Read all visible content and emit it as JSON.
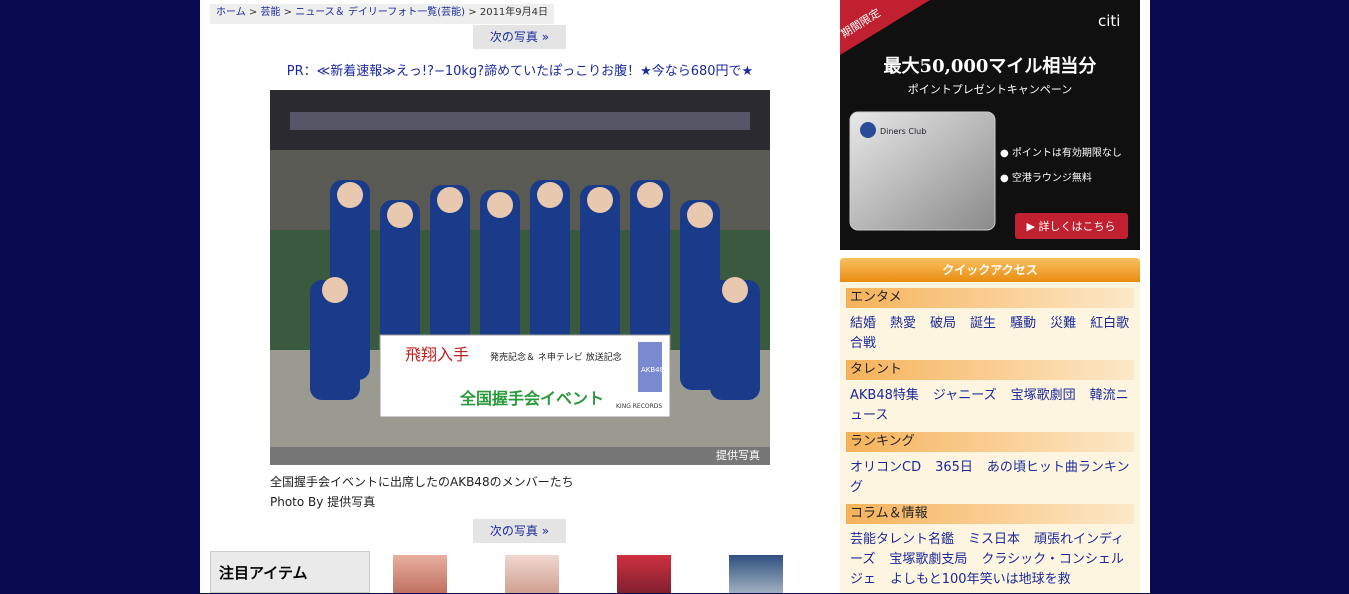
{
  "breadcrumb": {
    "home": "ホーム",
    "sep": " > ",
    "cat1": "芸能",
    "cat2": "ニュース＆ デイリーフォト一覧(芸能)",
    "date": "2011年9月4日"
  },
  "next_photo_label": "次の写真 »",
  "pr_text": "PR：≪新着速報≫えっ!?−10kg?諦めていたぽっこりお腹！★今なら680円で★",
  "photo": {
    "credit": "提供写真",
    "banner_text": "全国握手会イベント",
    "banner_left": "飛翔入手",
    "banner_right": "発売記念＆ ネ申テレビ 放送記念",
    "label_akb": "AKB48",
    "label_king": "KING RECORDS"
  },
  "caption": {
    "line1": "全国握手会イベントに出席したのAKB48のメンバーたち",
    "line2": "Photo By 提供写真"
  },
  "items_heading": "注目アイテム",
  "ad": {
    "badge": "期間限定",
    "brand": "citi",
    "headline": "最大50,000マイル相当分",
    "sub": "ポイントプレゼントキャンペーン",
    "point1": "● ポイントは有効期限なし",
    "point2": "● 空港ラウンジ無料",
    "cta": "▶ 詳しくはこちら",
    "card_name": "Diners Club"
  },
  "quick_access": {
    "title": "クイックアクセス",
    "sections": [
      {
        "title": "エンタメ",
        "links": [
          "結婚",
          "熱愛",
          "破局",
          "誕生",
          "騒動",
          "災難",
          "紅白歌合戦"
        ]
      },
      {
        "title": "タレント",
        "links": [
          "AKB48特集",
          "ジャニーズ",
          "宝塚歌劇団",
          "韓流ニュース"
        ]
      },
      {
        "title": "ランキング",
        "links": [
          "オリコンCD",
          "365日",
          "あの頃ヒット曲ランキング"
        ]
      },
      {
        "title": "コラム＆情報",
        "links": [
          "芸能タレント名鑑",
          "ミス日本",
          "頑張れインディーズ",
          "宝塚歌劇支局",
          "クラシック・コンシェルジェ",
          "よしもと100年笑いは地球を救"
        ]
      }
    ]
  },
  "colors": {
    "bg": "#0a0a50",
    "link": "#1a2a9a",
    "accent": "#e98c10"
  }
}
